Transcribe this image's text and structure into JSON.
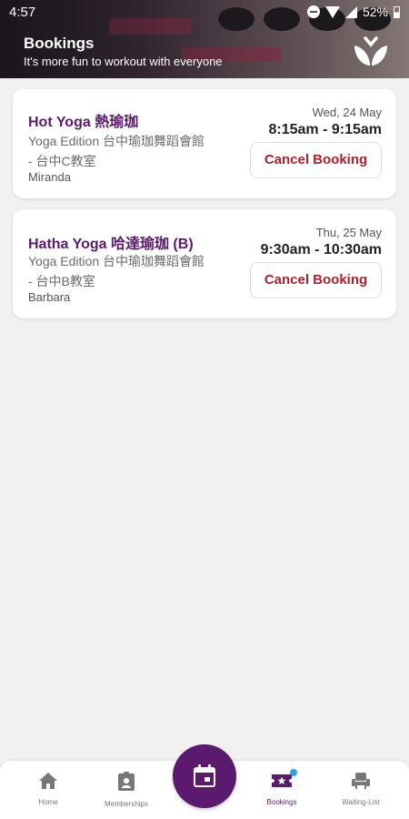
{
  "status_bar": {
    "time": "4:57",
    "battery": "52%"
  },
  "header": {
    "title": "Bookings",
    "subtitle": "It's more fun to workout with everyone"
  },
  "bookings": [
    {
      "class_name": "Hot Yoga 熱瑜珈",
      "studio_line1": "Yoga Edition 台中瑜珈舞蹈會館",
      "studio_line2": "- 台中C教室",
      "coach": "Miranda",
      "date": "Wed, 24 May",
      "time": "8:15am - 9:15am",
      "cancel_label": "Cancel Booking"
    },
    {
      "class_name": "Hatha Yoga 哈達瑜珈 (B)",
      "studio_line1": "Yoga Edition 台中瑜珈舞蹈會館",
      "studio_line2": "- 台中B教室",
      "coach": "Barbara",
      "date": "Thu, 25 May",
      "time": "9:30am - 10:30am",
      "cancel_label": "Cancel Booking"
    }
  ],
  "bottom_nav": {
    "items": [
      {
        "label": "Home",
        "icon": "home-icon"
      },
      {
        "label": "Memberships",
        "icon": "membership-card-icon"
      },
      {
        "label": "",
        "icon": "calendar-icon"
      },
      {
        "label": "Bookings",
        "icon": "ticket-star-icon",
        "active": true
      },
      {
        "label": "Waiting-List",
        "icon": "seat-icon"
      }
    ]
  },
  "colors": {
    "brand": "#5b1a6e",
    "cancel": "#b01f2e",
    "badge": "#29a3e6"
  }
}
